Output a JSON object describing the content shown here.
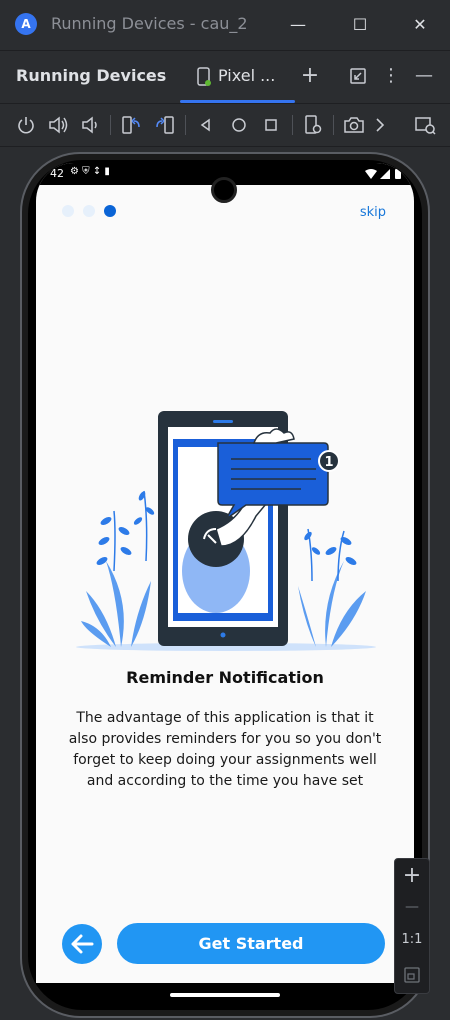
{
  "window": {
    "title": "Running Devices - cau_2",
    "minimize": "—",
    "maximize": "☐",
    "close": "✕"
  },
  "toolwindow": {
    "title": "Running Devices",
    "tab_label": "Pixel ...",
    "add": "+",
    "more": "⋮",
    "hide": "—"
  },
  "device": {
    "status_time": "42"
  },
  "onboarding": {
    "skip": "skip",
    "title": "Reminder Notification",
    "body": "The advantage of this application is that it also provides reminders for you so you don't forget to keep doing your assignments well and according to the time you have set",
    "cta": "Get Started",
    "page_count": 3,
    "active_page": 3,
    "badge": "1",
    "accent": "#2196f3",
    "accent_dark": "#0a64d6"
  },
  "zoom": {
    "in": "+",
    "out": "—",
    "actual": "1:1"
  },
  "icons": [
    "android-studio-logo",
    "power-icon",
    "volume-up-icon",
    "volume-down-icon",
    "rotate-left-icon",
    "rotate-right-icon",
    "back-icon",
    "home-icon",
    "overview-icon",
    "device-settings-icon",
    "camera-icon",
    "chevron-right-icon",
    "display-settings-icon"
  ]
}
